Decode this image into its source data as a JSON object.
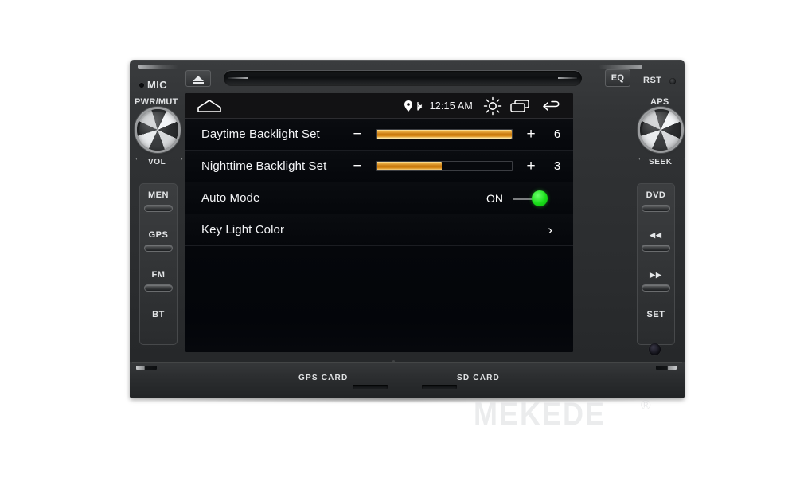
{
  "device": {
    "brand_watermark": "MEKEDE",
    "brand_registered": "®",
    "controls": {
      "mic_label": "MIC",
      "power_mute_label": "PWR/MUT",
      "volume_label": "VOL",
      "eq_label": "EQ",
      "reset_label": "RST",
      "aps_label": "APS",
      "seek_label": "SEEK",
      "eject_icon": "eject-icon",
      "left_knob_icon": "rotary-knob-icon",
      "right_knob_icon": "rotary-knob-icon"
    },
    "left_buttons": [
      {
        "label": "MEN",
        "icon": "menu-button-icon"
      },
      {
        "label": "GPS",
        "icon": "gps-button-icon"
      },
      {
        "label": "FM",
        "icon": "fm-radio-button-icon"
      },
      {
        "label": "BT",
        "icon": "bluetooth-button-icon"
      }
    ],
    "right_buttons": [
      {
        "label": "DVD",
        "icon": "dvd-button-icon"
      },
      {
        "label": "◀◀",
        "icon": "previous-track-icon"
      },
      {
        "label": "▶▶",
        "icon": "next-track-icon"
      },
      {
        "label": "SET",
        "icon": "settings-button-icon"
      }
    ],
    "bottom": {
      "gps_card_label": "GPS CARD",
      "sd_card_label": "SD CARD"
    }
  },
  "screen": {
    "statusbar": {
      "home_icon": "home-icon",
      "location_icon": "location-pin-icon",
      "bluetooth_icon": "bluetooth-icon",
      "time": "12:15 AM",
      "brightness_icon": "brightness-sun-icon",
      "recents_icon": "recent-apps-icon",
      "back_icon": "back-arrow-icon"
    },
    "settings_rows": [
      {
        "id": "daytime-backlight",
        "label": "Daytime Backlight Set",
        "type": "stepper-slider",
        "minus": "−",
        "plus": "+",
        "value": "6",
        "fill_percent": 100
      },
      {
        "id": "nighttime-backlight",
        "label": "Nighttime Backlight Set",
        "type": "stepper-slider",
        "minus": "−",
        "plus": "+",
        "value": "3",
        "fill_percent": 48
      },
      {
        "id": "auto-mode",
        "label": "Auto Mode",
        "type": "toggle",
        "state_label": "ON",
        "toggle_on": true,
        "toggle_color": "#1ee01e"
      },
      {
        "id": "key-light-color",
        "label": "Key Light Color",
        "type": "navigate",
        "chevron": "›"
      }
    ]
  },
  "colors": {
    "slider_accent": "#d98b18",
    "toggle_on": "#1ee01e",
    "screen_bg": "#04060a",
    "statusbar_bg": "#121214",
    "bezel": "#313335"
  }
}
